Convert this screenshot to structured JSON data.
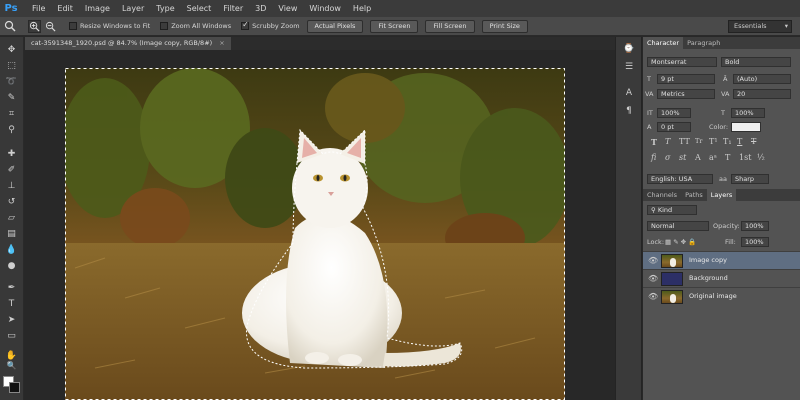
{
  "menubar": {
    "logo": "Ps",
    "items": [
      "File",
      "Edit",
      "Image",
      "Layer",
      "Type",
      "Select",
      "Filter",
      "3D",
      "View",
      "Window",
      "Help"
    ]
  },
  "options": {
    "resize_windows": "Resize Windows to Fit",
    "zoom_all": "Zoom All Windows",
    "scrubby_zoom": "Scrubby Zoom",
    "buttons": [
      "Actual Pixels",
      "Fit Screen",
      "Fill Screen",
      "Print Size"
    ],
    "workspace": "Essentials"
  },
  "document": {
    "tab_title": "cat-3591348_1920.psd @ 84.7% (Image copy, RGB/8#)",
    "close": "×"
  },
  "character_panel": {
    "tabs": [
      "Character",
      "Paragraph"
    ],
    "font_family": "Montserrat",
    "font_style": "Bold",
    "font_size": "9 pt",
    "leading": "(Auto)",
    "kerning": "Metrics",
    "tracking": "20",
    "vertical_scale": "100%",
    "horizontal_scale": "100%",
    "baseline_shift": "0 pt",
    "color_label": "Color:",
    "language": "English: USA",
    "antialias": "Sharp"
  },
  "layers_panel": {
    "tabs": [
      "Channels",
      "Paths",
      "Layers"
    ],
    "filter": "Kind",
    "blend_mode": "Normal",
    "opacity_label": "Opacity:",
    "opacity": "100%",
    "lock_label": "Lock:",
    "fill_label": "Fill:",
    "fill": "100%",
    "layers": [
      {
        "name": "Image copy",
        "selected": true,
        "thumb": "cat"
      },
      {
        "name": "Background",
        "selected": false,
        "thumb": "blue"
      },
      {
        "name": "Original image",
        "selected": false,
        "thumb": "cat"
      }
    ]
  },
  "colors": {
    "accent": "#38a0f8",
    "selected_layer": "#5f6e82",
    "background_layer_fill": "#2c2f66"
  }
}
